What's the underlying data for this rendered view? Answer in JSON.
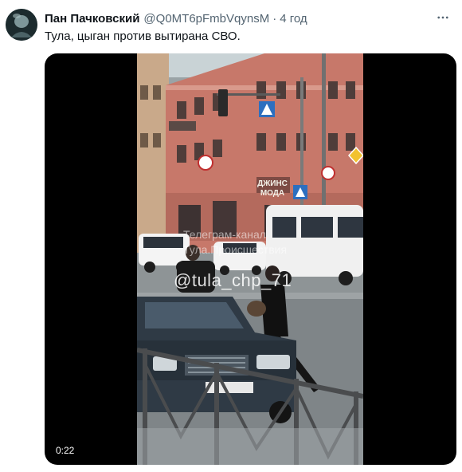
{
  "tweet": {
    "author_name": "Пан Пачковский",
    "handle": "@Q0MT6pFmbVqynsM",
    "separator": "·",
    "time": "4 год",
    "text": "Тула, цыган против вытирана СВО."
  },
  "media": {
    "duration": "0:22",
    "watermark": "@tula_chp_71",
    "watermark_sub_1": "Телеграм-канал",
    "watermark_sub_2": "Тула.Происшествия",
    "shop_sign": "ДЖИНС МОДА"
  },
  "icons": {
    "more": "more-icon",
    "avatar": "avatar-image"
  }
}
